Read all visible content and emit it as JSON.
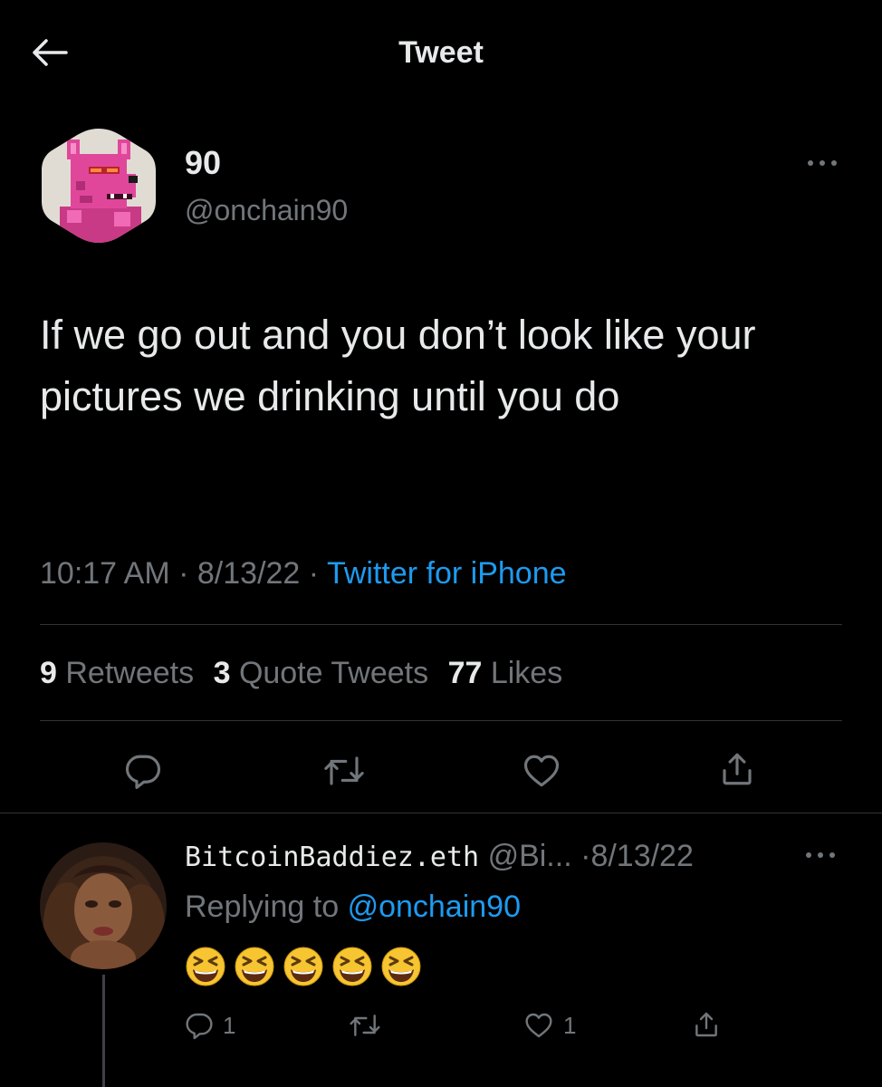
{
  "header": {
    "title": "Tweet"
  },
  "tweet": {
    "author_name": "90",
    "author_handle": "@onchain90",
    "text": "If we go out and you don’t look like your pictures we drinking until you do",
    "time": "10:17 AM",
    "date": "8/13/22",
    "source": "Twitter for iPhone",
    "separator": "·",
    "stats": {
      "retweets_count": "9",
      "retweets_label": "Retweets",
      "quotes_count": "3",
      "quotes_label": "Quote Tweets",
      "likes_count": "77",
      "likes_label": "Likes"
    }
  },
  "reply": {
    "author_name": "BitcoinBaddiez.eth",
    "author_handle": "@Bi...",
    "separator": "·",
    "date": "8/13/22",
    "replying_label": "Replying to",
    "replying_to": "@onchain90",
    "emojis": [
      "grinning-squinting-face",
      "grinning-squinting-face",
      "grinning-squinting-face",
      "grinning-squinting-face",
      "grinning-squinting-face"
    ],
    "reply_count": "1",
    "like_count": "1"
  },
  "colors": {
    "background": "#000000",
    "text": "#e7e9ea",
    "secondary": "#71767b",
    "accent": "#1d9bf0",
    "divider": "#2f3336",
    "avatar_main_bg": "#e0dcd4",
    "avatar_main_creature": "#e0479b"
  },
  "icons": {
    "back": "arrow-left-icon",
    "more": "more-horizontal-icon",
    "reply": "comment-icon",
    "retweet": "retweet-icon",
    "like": "heart-icon",
    "share": "share-icon"
  }
}
